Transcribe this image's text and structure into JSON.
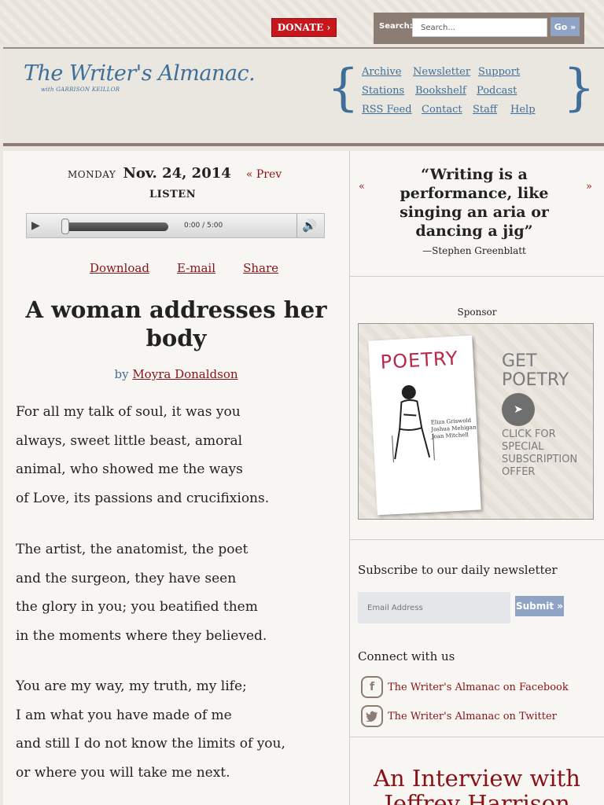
{
  "topbar": {
    "donate_label": "DONATE ›",
    "search_label": "Search:",
    "search_placeholder": "Search...",
    "go_label": "Go »"
  },
  "header": {
    "logo_text": "The Writer's Almanac.",
    "logo_sub": "with GARRISON KEILLOR",
    "nav": [
      [
        "Archive",
        "Newsletter",
        "Support"
      ],
      [
        "Stations",
        "Bookshelf",
        "Podcast"
      ],
      [
        "RSS Feed",
        "Contact",
        "Staff",
        "Help"
      ]
    ]
  },
  "episode": {
    "day": "MONDAY",
    "date": "Nov. 24, 2014",
    "prev_label": "« Prev",
    "listen_label": "LISTEN",
    "player_time": "0:00 / 5:00",
    "actions": [
      "Download",
      "E-mail",
      "Share"
    ]
  },
  "poem": {
    "title": "A woman addresses her body",
    "by": "by",
    "author": "Moyra Donaldson",
    "stanzas": [
      [
        "For all my talk of soul, it was you",
        "always, sweet little beast, amoral",
        "animal, who showed me the ways",
        "of Love, its passions and crucifixions."
      ],
      [
        "The artist, the anatomist, the poet",
        "and the surgeon, they have seen",
        "the glory in you; you beatified them",
        "in the moments where they believed."
      ],
      [
        "You are my way, my truth, my life;",
        "I am what you have made of me",
        "and still I do not know the limits of you,",
        "or where you will take me next."
      ]
    ]
  },
  "quote": {
    "prev_arrow": "«",
    "next_arrow": "»",
    "text": "“Writing is a performance, like singing an aria or dancing a jig”",
    "author": "—Stephen Greenblatt"
  },
  "sponsor": {
    "label": "Sponsor",
    "mag_title": "POETRY",
    "mag_names": [
      "Eliza Griswold",
      "Joshua Mehigan",
      "Joan Mitchell"
    ],
    "cta_lines": [
      "GET",
      "POETRY"
    ],
    "sub_lines": [
      "CLICK FOR",
      "SPECIAL",
      "SUBSCRIPTION",
      "OFFER"
    ]
  },
  "newsletter": {
    "title": "Subscribe to our daily newsletter",
    "email_placeholder": "Email Address",
    "submit_label": "Submit »"
  },
  "connect": {
    "title": "Connect with us",
    "facebook_icon": "f",
    "facebook_label": "The Writer's Almanac on Facebook",
    "twitter_label": "The Writer's Almanac on Twitter"
  },
  "interview": {
    "title": "An Interview with Jeffrey Harrison"
  },
  "colors": {
    "accent_red": "#8a1217",
    "accent_blue": "#3f6f98",
    "donate_red": "#c8161d",
    "button_blue": "#8fa4c4"
  }
}
